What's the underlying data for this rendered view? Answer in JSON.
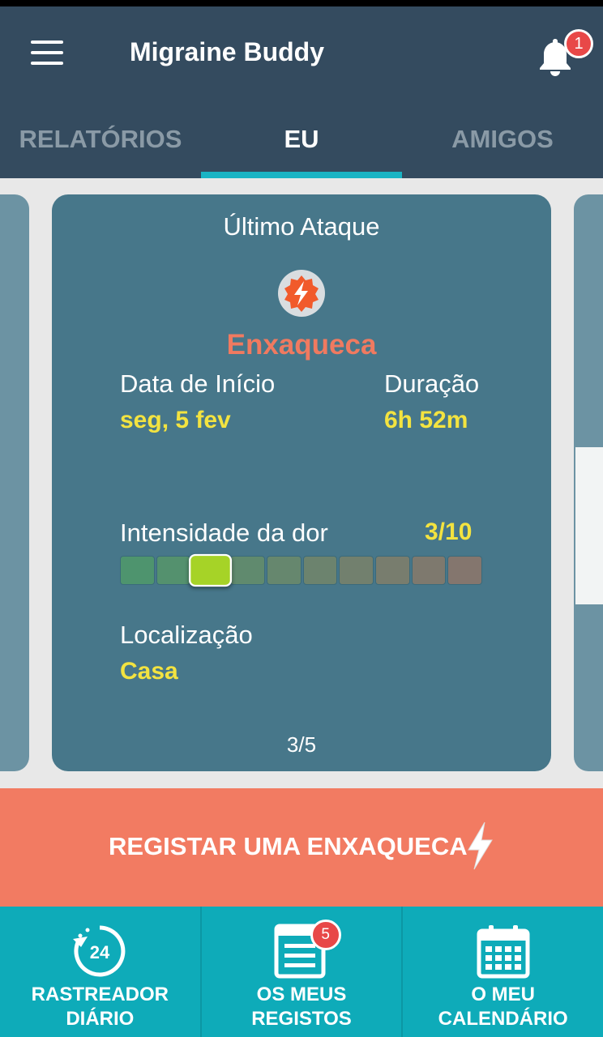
{
  "app": {
    "title": "Migraine Buddy"
  },
  "header": {
    "menu_icon": "hamburger-menu-icon",
    "notifications": {
      "icon": "bell-icon",
      "count": "1"
    }
  },
  "tabs": [
    {
      "label": "RELATÓRIOS",
      "active": false
    },
    {
      "label": "EU",
      "active": true
    },
    {
      "label": "AMIGOS",
      "active": false
    }
  ],
  "card": {
    "title": "Último Ataque",
    "icon": "migraine-bolt-icon",
    "type": "Enxaqueca",
    "start_label": "Data de Início",
    "start_value": "seg, 5 fev",
    "duration_label": "Duração",
    "duration_value": "6h 52m",
    "pain_label": "Intensidade da dor",
    "pain_value": "3/10",
    "pain_level": 3,
    "pain_max": 10,
    "location_label": "Localização",
    "location_value": "Casa",
    "pager": "3/5"
  },
  "cta": {
    "label": "REGISTAR UMA ENXAQUECA",
    "icon": "lightning-bolt-icon"
  },
  "bottom_nav": [
    {
      "label": "RASTREADOR\nDIÁRIO",
      "icon": "daily-tracker-24-icon"
    },
    {
      "label": "OS MEUS\nREGISTOS",
      "icon": "records-list-icon",
      "badge": "5"
    },
    {
      "label": "O MEU\nCALENDÁRIO",
      "icon": "calendar-icon"
    }
  ],
  "colors": {
    "appbar": "#344b5f",
    "tab_indicator": "#1ab4c4",
    "card": "#47778a",
    "accent_yellow": "#f3e340",
    "migraine_orange": "#f07a60",
    "cta": "#f27b62",
    "bottom_nav": "#0eabb9",
    "pain_selected": "#a6d327"
  }
}
